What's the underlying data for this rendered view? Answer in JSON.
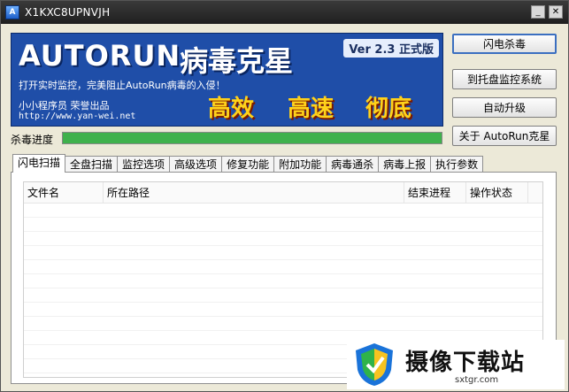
{
  "window": {
    "title": "X1KXC8UPNVJH"
  },
  "banner": {
    "logo": "AUTORUN",
    "title_cn": "病毒克星",
    "version": "Ver 2.3 正式版",
    "slogan": "打开实时监控，完美阻止AutoRun病毒的入侵！",
    "author": "小小程序员 荣誉出品",
    "website": "http://www.yan-wei.net",
    "keywords": [
      "高效",
      "高速",
      "彻底"
    ]
  },
  "buttons": {
    "scan": "闪电杀毒",
    "tray": "到托盘监控系统",
    "upgrade": "自动升级",
    "about": "关于 AutoRun克星"
  },
  "progress": {
    "label": "杀毒进度",
    "value": 1.0
  },
  "tabs": [
    "闪电扫描",
    "全盘扫描",
    "监控选项",
    "高级选项",
    "修复功能",
    "附加功能",
    "病毒通杀",
    "病毒上报",
    "执行参数"
  ],
  "list": {
    "columns": [
      "文件名",
      "所在路径",
      "结束进程",
      "操作状态"
    ],
    "rows": []
  },
  "watermark": {
    "title": "摄像下载站",
    "url": "sxtgr.com"
  },
  "colors": {
    "banner": "#1f4ea8",
    "progress": "#3fb14c",
    "keyword": "#ffd21a"
  }
}
